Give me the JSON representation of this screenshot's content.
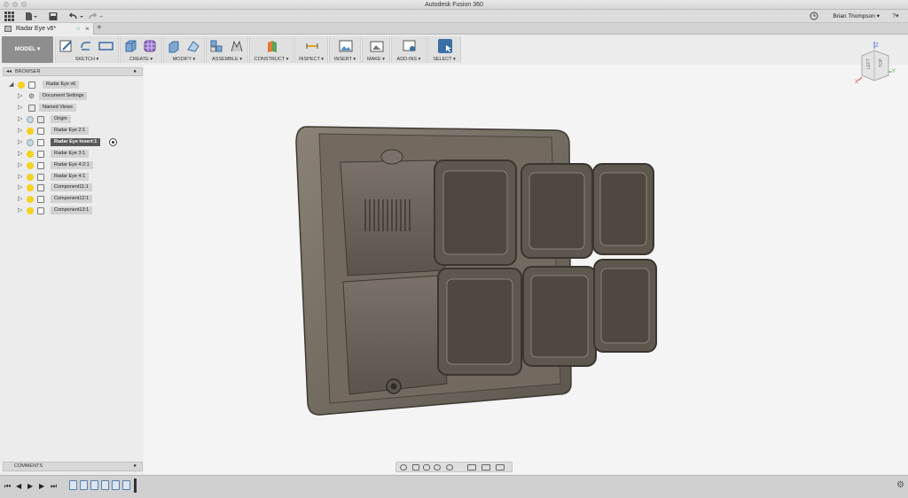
{
  "window": {
    "title": "Autodesk Fusion 360"
  },
  "quick_access": {
    "user_name": "Brian Thompson ▾",
    "grid_icon": "apps-grid-icon",
    "file_icon": "file-icon",
    "save_icon": "save-icon",
    "undo_icon": "undo-icon",
    "redo_icon": "redo-icon",
    "history_icon": "clock-icon",
    "help_label": "?▾"
  },
  "document_tab": {
    "label": "Radar Eye v6*"
  },
  "toolbar": {
    "workspace": "MODEL ▾",
    "groups": [
      {
        "label": "SKETCH ▾"
      },
      {
        "label": "CREATE ▾"
      },
      {
        "label": "MODIFY ▾"
      },
      {
        "label": "ASSEMBLE ▾"
      },
      {
        "label": "CONSTRUCT ▾"
      },
      {
        "label": "INSPECT ▾"
      },
      {
        "label": "INSERT ▾"
      },
      {
        "label": "MAKE ▾"
      },
      {
        "label": "ADD-INS ▾"
      },
      {
        "label": "SELECT ▾"
      }
    ]
  },
  "browser": {
    "title": "BROWSER",
    "items": [
      {
        "label": "Radar Eye v6"
      },
      {
        "label": "Document Settings"
      },
      {
        "label": "Named Views"
      },
      {
        "label": "Origin"
      },
      {
        "label": "Radar Eye 2:1"
      },
      {
        "label": "Radar Eye Insert:1"
      },
      {
        "label": "Radar Eye 3:1"
      },
      {
        "label": "Radar Eye 4:2:1"
      },
      {
        "label": "Radar Eye 4:1"
      },
      {
        "label": "Component11:1"
      },
      {
        "label": "Component12:1"
      },
      {
        "label": "Component13:1"
      }
    ]
  },
  "comments": {
    "title": "COMMENTS"
  },
  "viewcube": {
    "face_left": "LEFT",
    "face_top": "TOP",
    "axis_z": "Z",
    "axis_y": "Y",
    "axis_x": "X"
  },
  "colors": {
    "model_body": "#6e665c",
    "bulb": "#f4d21f",
    "select_accent": "#3a6ea5"
  }
}
